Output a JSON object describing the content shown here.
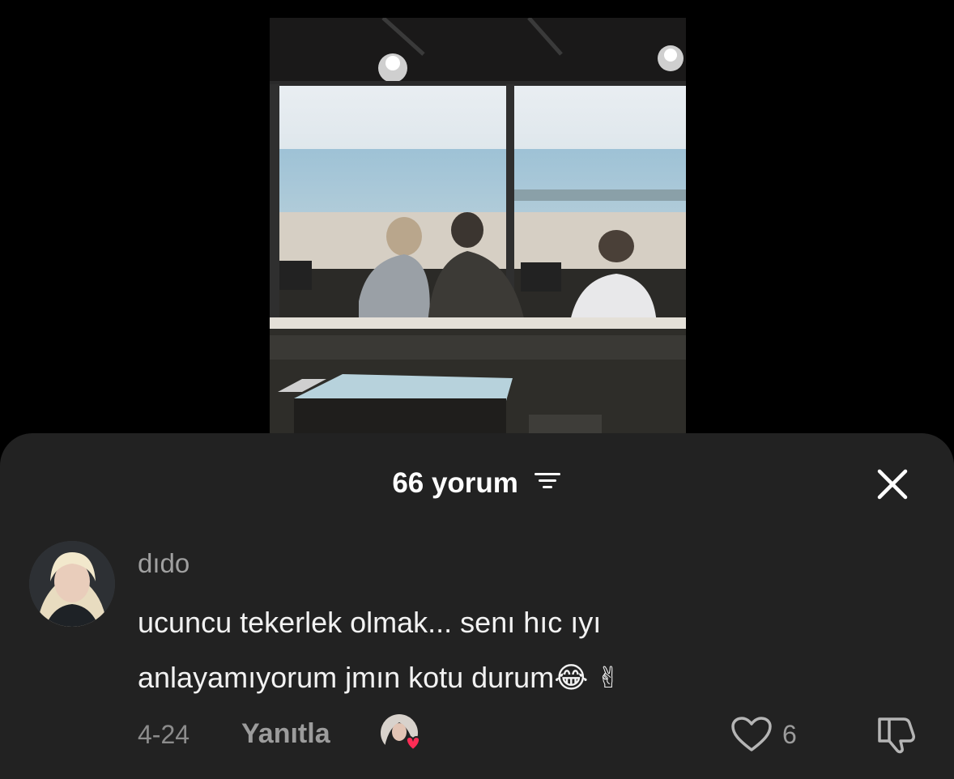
{
  "header": {
    "count_label": "66 yorum",
    "filter_icon": "filter-lines-icon",
    "close_icon": "close-x-icon"
  },
  "comment": {
    "username": "dıdo",
    "text_line1": "ucuncu tekerlek olmak... senı hıc ıyı",
    "text_line2": "anlayamıyorum jmın kotu durum",
    "emoji_laugh": "😂",
    "emoji_victory": "✌",
    "date": "4-24",
    "reply_label": "Yanıtla",
    "like_count": "6",
    "like_icon": "heart-outline-icon",
    "dislike_icon": "thumbs-down-icon"
  },
  "colors": {
    "sheet_bg": "#222222",
    "page_bg": "#000000",
    "accent_heart": "#fe2c55"
  }
}
